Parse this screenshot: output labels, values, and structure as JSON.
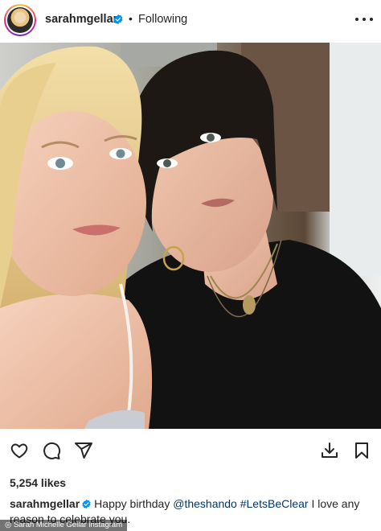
{
  "post": {
    "username": "sarahmgellar",
    "separator": "•",
    "follow_status": "Following",
    "likes": "5,254 likes",
    "caption": {
      "username": "sarahmgellar",
      "text_start": "Happy birthday ",
      "mention": "@theshando",
      "space": " ",
      "hashtag": "#LetsBeClear",
      "text_end": " I love any reason to celebrate you."
    }
  },
  "icons": {
    "header": [
      "verified-badge-icon",
      "more-options-icon"
    ],
    "actions": [
      "heart-icon",
      "comment-icon",
      "share-icon",
      "download-icon",
      "bookmark-icon"
    ]
  },
  "colors": {
    "verified_blue": "#0095f6",
    "link_blue": "#00376b",
    "text": "#262626"
  },
  "credit": "Sarah Michelle Gellar instagram"
}
